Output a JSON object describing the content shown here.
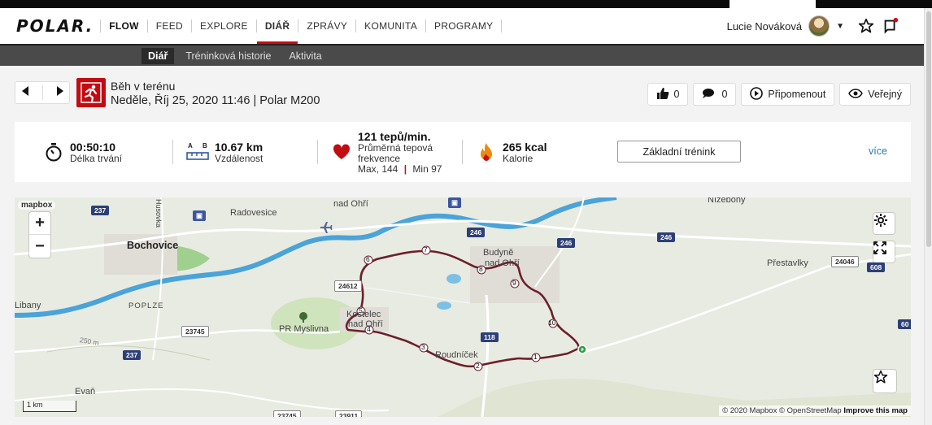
{
  "brand": "POLAR.",
  "nav": {
    "flow": "FLOW",
    "items": [
      "FEED",
      "EXPLORE",
      "DIÁŘ",
      "ZPRÁVY",
      "KOMUNITA",
      "PROGRAMY"
    ],
    "active_index": 2
  },
  "user": {
    "name": "Lucie Nováková"
  },
  "subnav": [
    "Diář",
    "Tréninková historie",
    "Aktivita"
  ],
  "session": {
    "sport": "Běh v terénu",
    "datetime_device": "Neděle, Říj 25, 2020 11:46 | Polar M200"
  },
  "actions": {
    "likes": "0",
    "comments": "0",
    "remind": "Připomenout",
    "visibility": "Veřejný"
  },
  "stats": {
    "duration": {
      "value": "00:50:10",
      "label": "Délka trvání"
    },
    "distance": {
      "value": "10.67 km",
      "label": "Vzdálenost",
      "icon_a": "A",
      "icon_b": "B"
    },
    "heart": {
      "value": "121 tepů/min.",
      "label1": "Průměrná tepová",
      "label2": "frekvence",
      "max": "Max, 144",
      "sep": "|",
      "min": "Min 97"
    },
    "calories": {
      "value": "265 kcal",
      "label": "Kalorie"
    },
    "basic_button": "Základní trénink",
    "more": "více"
  },
  "map": {
    "logo": "mapbox",
    "zoom_in": "+",
    "zoom_out": "−",
    "scale": "1 km",
    "attribution": "© 2020 Mapbox © OpenStreetMap",
    "improve": "Improve this map",
    "places": {
      "bochovice": "Bochovice",
      "radovesice": "Radovesice",
      "nadohri": "nad Ohří",
      "budyne": "Budyně",
      "nadohri2": "nad Ohří",
      "poplze": "POPLZE",
      "prmyslivna": "PR Myslivna",
      "kostelec": "Kostelec",
      "nadohri3": "nad Ohří",
      "roudnicek": "Roudníček",
      "prestavlky": "Přestavlky",
      "nizebohy": "Nížebohy",
      "evan": "Evaň",
      "libany": "Libany",
      "husovka": "Husovka"
    },
    "roads": {
      "r237a": "237",
      "r237b": "237",
      "r246a": "246",
      "r246b": "246",
      "r246c": "246",
      "r118": "118",
      "r24612": "24612",
      "r23745": "23745",
      "r23745b": "23745",
      "r23911": "23911",
      "r24046": "24046",
      "r608": "608",
      "r60": "60",
      "elev": "250 m"
    },
    "km_markers": [
      "1",
      "2",
      "3",
      "4",
      "5",
      "6",
      "7",
      "8",
      "9",
      "10"
    ]
  },
  "colors": {
    "brand_red": "#d10a11",
    "route": "#6d1f2e",
    "river": "#4aa3d9",
    "road_major": "#ffffff",
    "link": "#2a7ab0"
  }
}
